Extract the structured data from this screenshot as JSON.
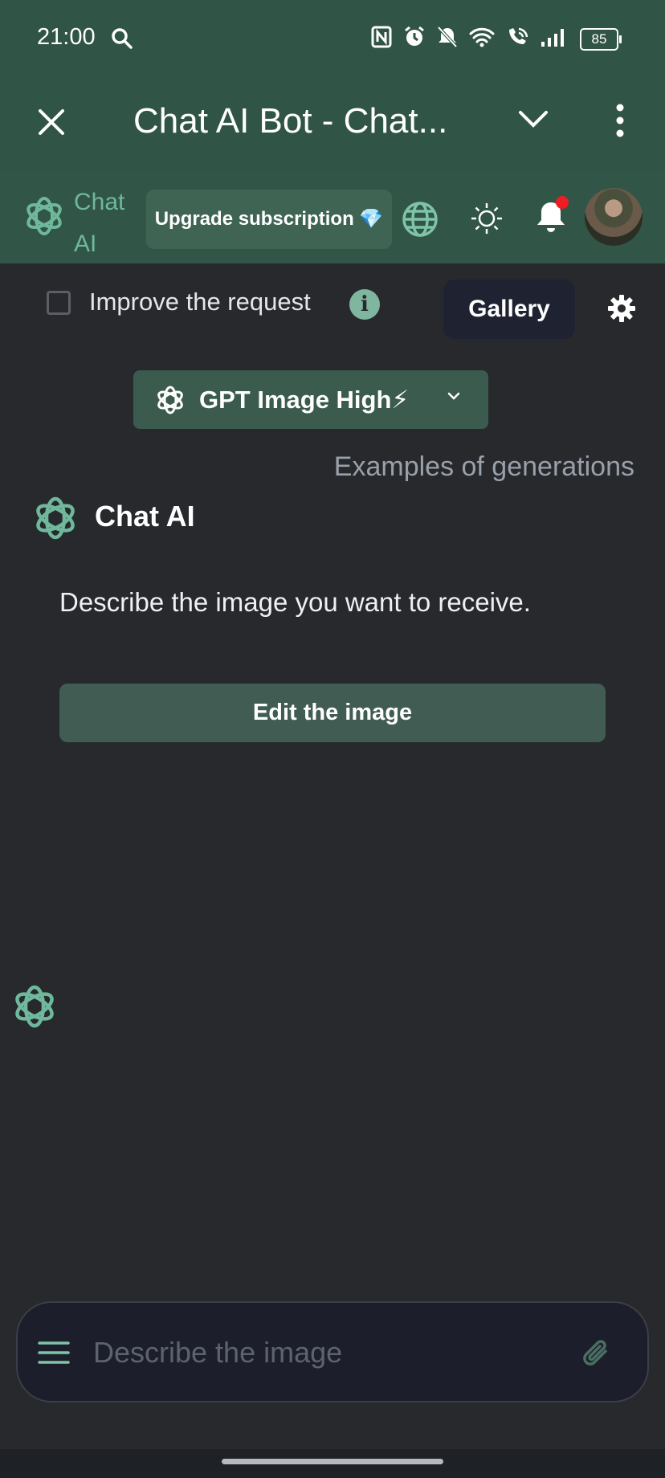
{
  "status_bar": {
    "time": "21:00",
    "battery": "85",
    "icons": [
      "search-icon",
      "nfc-icon",
      "alarm-icon",
      "mute-icon",
      "wifi-icon",
      "wifi-call-icon",
      "signal-icon",
      "battery-icon"
    ]
  },
  "app_bar": {
    "title": "Chat AI Bot - Chat..."
  },
  "top_bar": {
    "brand": "Chat AI",
    "upgrade_label": "Upgrade subscription 💎"
  },
  "controls": {
    "improve_label": "Improve the request",
    "improve_checked": false,
    "gallery_label": "Gallery"
  },
  "model": {
    "label": "GPT Image High⚡"
  },
  "examples_link": "Examples of generations",
  "chat": {
    "sender": "Chat AI",
    "message": "Describe the image you want to receive.",
    "edit_label": "Edit the image"
  },
  "composer": {
    "placeholder": "Describe the image"
  },
  "colors": {
    "header_green": "#305445",
    "accent_green": "#6fb89c",
    "background": "#27292d",
    "notification_dot": "#ee1c24"
  }
}
